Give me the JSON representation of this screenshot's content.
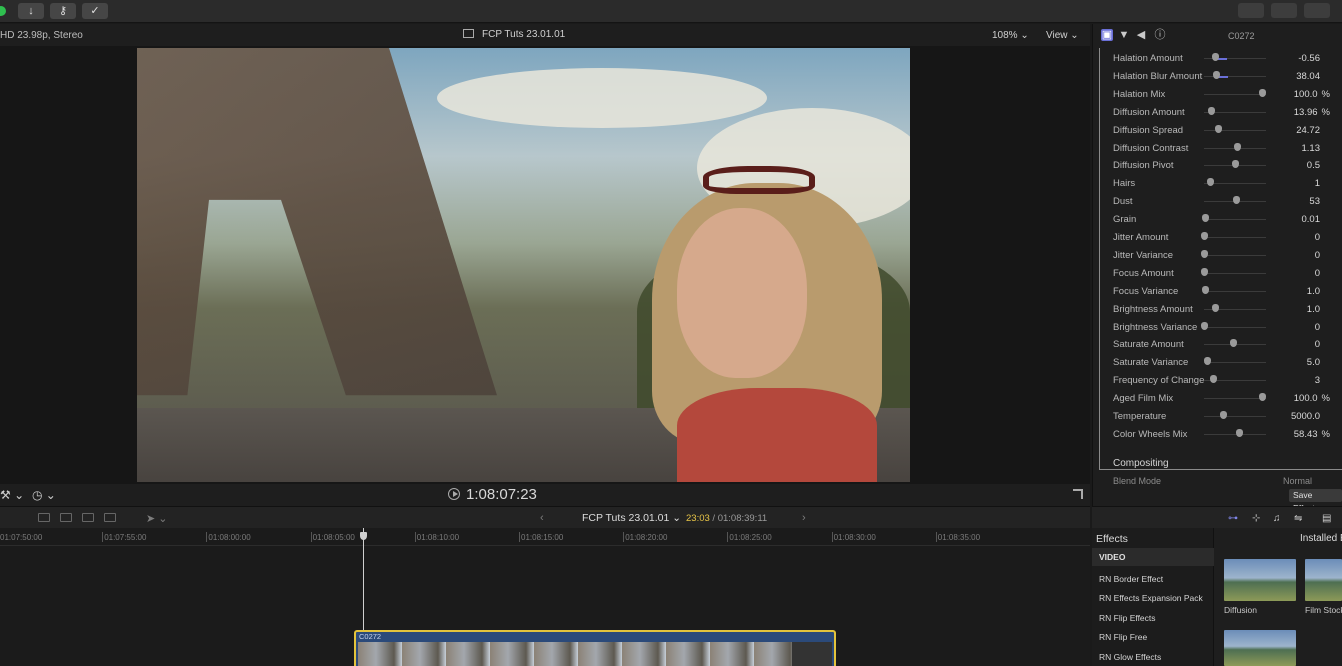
{
  "toolbar": {
    "import_icon": "down-arrow-icon",
    "keyword_icon": "key-icon",
    "background_tasks_icon": "check-circle-icon"
  },
  "viewer": {
    "format": "HD 23.98p, Stereo",
    "project_title": "FCP Tuts 23.01.01",
    "zoom": "108%",
    "view_menu": "View",
    "timecode": "1:08:07:23"
  },
  "inspector": {
    "clip_name": "C0272",
    "params": [
      {
        "label": "Halation Amount",
        "value": "-0.56",
        "unit": "",
        "level": 0.18,
        "active": true
      },
      {
        "label": "Halation Blur Amount",
        "value": "38.04",
        "unit": "",
        "level": 0.2,
        "active": true
      },
      {
        "label": "Halation Mix",
        "value": "100.0",
        "unit": "%",
        "level": 0.93,
        "active": false
      },
      {
        "label": "Diffusion Amount",
        "value": "13.96",
        "unit": "%",
        "level": 0.12,
        "active": false
      },
      {
        "label": "Diffusion Spread",
        "value": "24.72",
        "unit": "",
        "level": 0.22,
        "active": false
      },
      {
        "label": "Diffusion Contrast",
        "value": "1.13",
        "unit": "",
        "level": 0.53,
        "active": false
      },
      {
        "label": "Diffusion Pivot",
        "value": "0.5",
        "unit": "",
        "level": 0.5,
        "active": false
      },
      {
        "label": "Hairs",
        "value": "1",
        "unit": "",
        "level": 0.1,
        "active": false
      },
      {
        "label": "Dust",
        "value": "53",
        "unit": "",
        "level": 0.52,
        "active": false
      },
      {
        "label": "Grain",
        "value": "0.01",
        "unit": "",
        "level": 0.01,
        "active": false
      },
      {
        "label": "Jitter Amount",
        "value": "0",
        "unit": "",
        "level": 0.0,
        "active": false
      },
      {
        "label": "Jitter Variance",
        "value": "0",
        "unit": "",
        "level": 0.0,
        "active": false
      },
      {
        "label": "Focus Amount",
        "value": "0",
        "unit": "",
        "level": 0.0,
        "active": false
      },
      {
        "label": "Focus Variance",
        "value": "1.0",
        "unit": "",
        "level": 0.01,
        "active": false
      },
      {
        "label": "Brightness Amount",
        "value": "1.0",
        "unit": "",
        "level": 0.17,
        "active": false
      },
      {
        "label": "Brightness Variance",
        "value": "0",
        "unit": "",
        "level": 0.0,
        "active": false
      },
      {
        "label": "Saturate Amount",
        "value": "0",
        "unit": "",
        "level": 0.47,
        "active": false
      },
      {
        "label": "Saturate Variance",
        "value": "5.0",
        "unit": "",
        "level": 0.05,
        "active": false
      },
      {
        "label": "Frequency of Change",
        "value": "3",
        "unit": "",
        "level": 0.15,
        "active": false
      },
      {
        "label": "Aged Film Mix",
        "value": "100.0",
        "unit": "%",
        "level": 0.93,
        "active": false
      },
      {
        "label": "Temperature",
        "value": "5000.0",
        "unit": "",
        "level": 0.3,
        "active": false
      },
      {
        "label": "Color Wheels Mix",
        "value": "58.43",
        "unit": "%",
        "level": 0.56,
        "active": false
      }
    ],
    "compositing_label": "Compositing",
    "blend_mode_label": "Blend Mode",
    "blend_mode_value": "Normal",
    "save_effects": "Save Effects"
  },
  "timeline": {
    "title": "FCP Tuts 23.01.01",
    "current_time": "23:03",
    "total_time": "01:08:39:11",
    "ruler": [
      "01:07:50:00",
      "01:07:55:00",
      "01:08:00:00",
      "01:08:05:00",
      "01:08:10:00",
      "01:08:15:00",
      "01:08:20:00",
      "01:08:25:00",
      "01:08:30:00",
      "01:08:35:00"
    ],
    "clip_label": "C0272"
  },
  "effects": {
    "title": "Effects",
    "installed": "Installed E",
    "category_header": "VIDEO",
    "categories": [
      "RN Border Effect",
      "RN Effects Expansion Pack",
      "RN Flip Effects",
      "RN Flip Free",
      "RN Glow Effects"
    ],
    "thumbnails": [
      "Diffusion",
      "Film Stock"
    ]
  },
  "colors": {
    "accent": "#6a6fd8",
    "clip_border": "#e3c33c",
    "timecode_current": "#e8c547"
  }
}
